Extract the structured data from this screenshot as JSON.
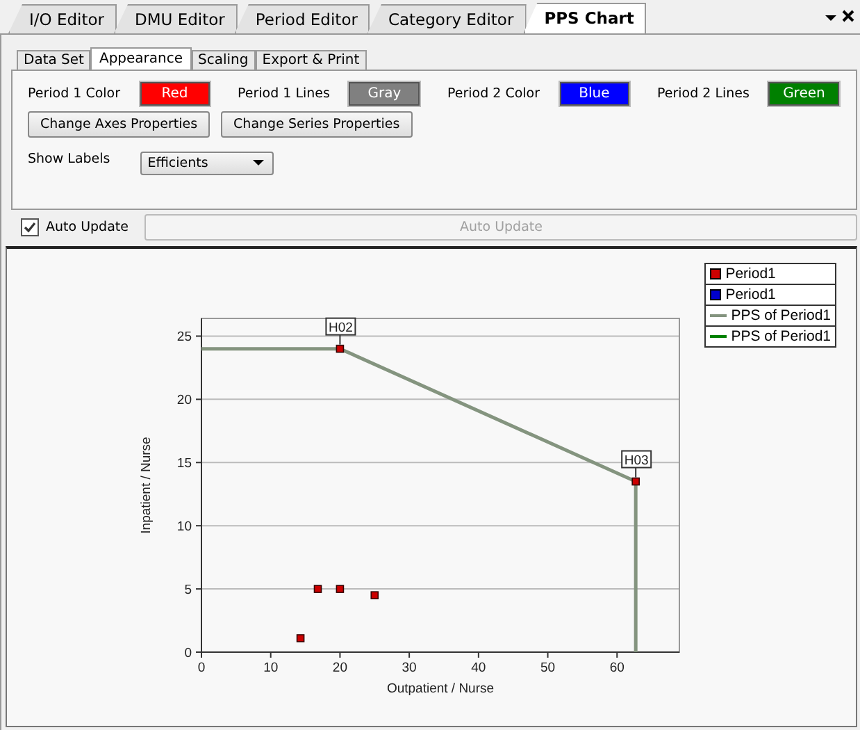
{
  "doc_tabs": [
    {
      "label": "I/O Editor",
      "selected": false
    },
    {
      "label": "DMU Editor",
      "selected": false
    },
    {
      "label": "Period Editor",
      "selected": false
    },
    {
      "label": "Category Editor",
      "selected": false
    },
    {
      "label": "PPS Chart",
      "selected": true
    }
  ],
  "inner_tabs": [
    {
      "label": "Data Set",
      "selected": false
    },
    {
      "label": "Appearance",
      "selected": true
    },
    {
      "label": "Scaling",
      "selected": false
    },
    {
      "label": "Export & Print",
      "selected": false
    }
  ],
  "color_settings": [
    {
      "label": "Period 1 Color",
      "value": "Red",
      "color": "#ff0000"
    },
    {
      "label": "Period 1 Lines",
      "value": "Gray",
      "color": "#808080"
    },
    {
      "label": "Period 2 Color",
      "value": "Blue",
      "color": "#0000ff"
    },
    {
      "label": "Period 2 Lines",
      "value": "Green",
      "color": "#008000"
    }
  ],
  "property_buttons": [
    "Change Axes Properties",
    "Change Series Properties"
  ],
  "show_labels": {
    "label": "Show Labels",
    "value": "Efficients"
  },
  "auto_update": {
    "label": "Auto Update",
    "checked": true,
    "button": "Auto Update",
    "disabled": true
  },
  "chart_data": {
    "type": "scatter",
    "xlabel": "Outpatient / Nurse",
    "ylabel": "Inpatient / Nurse",
    "xlim": [
      0,
      69
    ],
    "ylim": [
      0,
      26.4
    ],
    "xticks": [
      0,
      10,
      20,
      30,
      40,
      50,
      60
    ],
    "yticks": [
      0,
      5,
      10,
      15,
      20,
      25
    ],
    "grid": true,
    "series": [
      {
        "name": "Period1",
        "color": "#cc0000",
        "x": [
          14.3,
          16.8,
          20,
          25,
          20,
          62.7
        ],
        "values": [
          1.1,
          5,
          5,
          4.5,
          24,
          13.5
        ]
      },
      {
        "name": "Period1",
        "color": "#0000cc"
      },
      {
        "name": "PPS of Period1",
        "color": "#84947f",
        "type": "line",
        "x": [
          0,
          20,
          62.7,
          62.7
        ],
        "values": [
          24,
          24,
          13.5,
          0
        ]
      },
      {
        "name": "PPS of Period1",
        "color": "#008000",
        "type": "line"
      }
    ],
    "annotations": [
      {
        "text": "H02",
        "x": 20,
        "y": 24
      },
      {
        "text": "H03",
        "x": 62.7,
        "y": 13.5
      }
    ]
  }
}
